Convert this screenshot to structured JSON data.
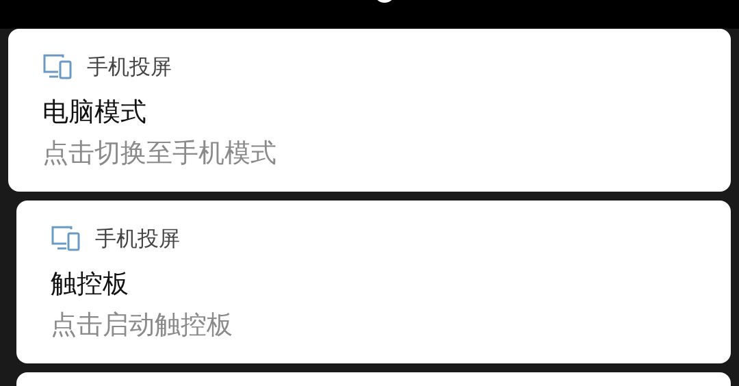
{
  "notifications": [
    {
      "app_name": "手机投屏",
      "title": "电脑模式",
      "subtitle": "点击切换至手机模式"
    },
    {
      "app_name": "手机投屏",
      "title": "触控板",
      "subtitle": "点击启动触控板"
    }
  ]
}
